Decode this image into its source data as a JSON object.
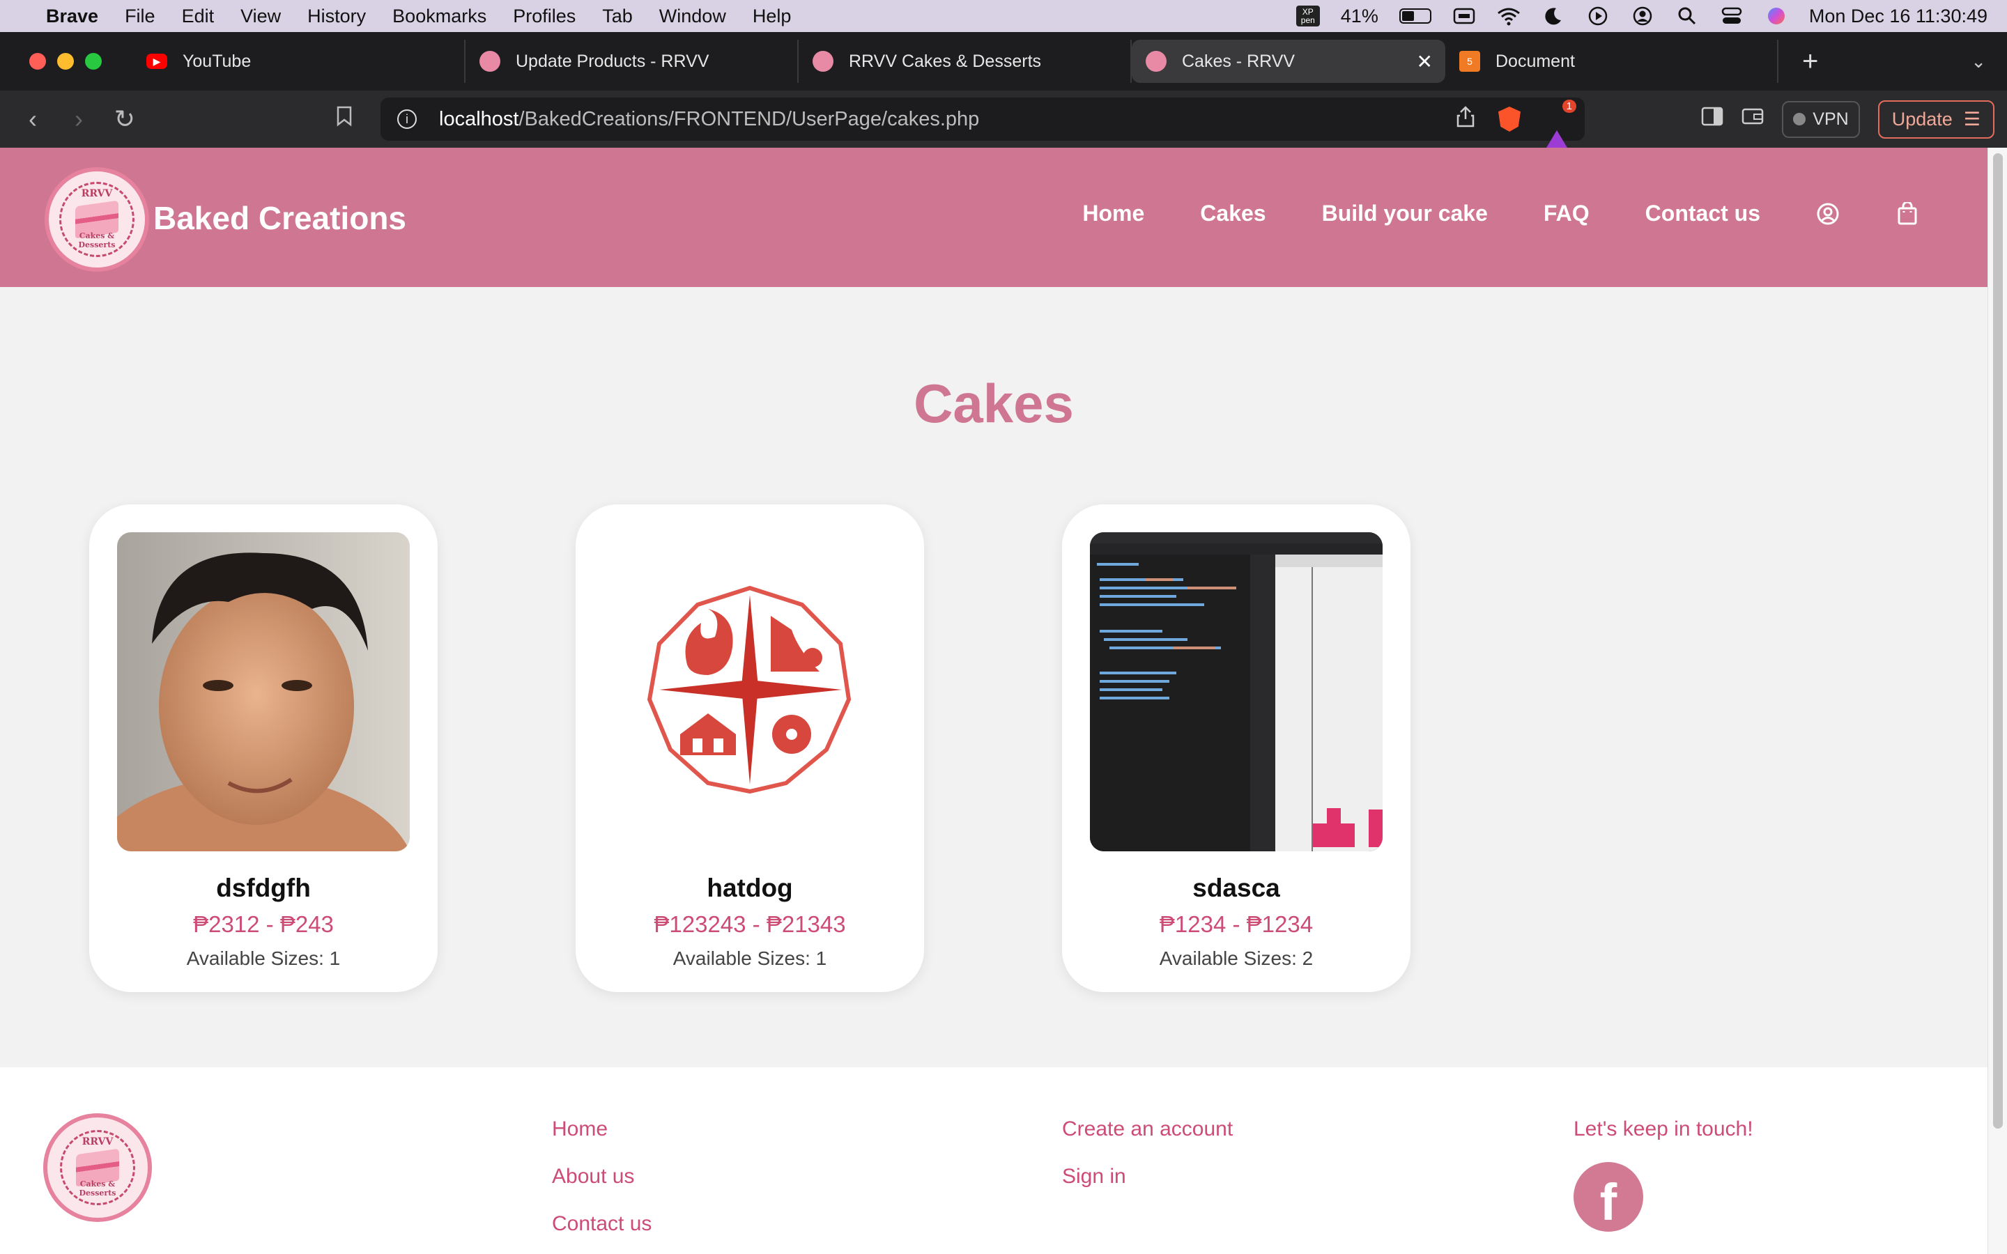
{
  "menubar": {
    "items": [
      "Brave",
      "File",
      "Edit",
      "View",
      "History",
      "Bookmarks",
      "Profiles",
      "Tab",
      "Window",
      "Help"
    ],
    "battery_percent": "41%",
    "battery_level": 0.41,
    "datetime": "Mon Dec 16  11:30:49",
    "xp_pen": "XP pen"
  },
  "tabs": [
    {
      "title": "YouTube",
      "favicon_color": "#ff0000",
      "active": false
    },
    {
      "title": "Update Products - RRVV",
      "favicon_color": "#e88aa5",
      "active": false
    },
    {
      "title": "RRVV Cakes & Desserts",
      "favicon_color": "#e88aa5",
      "active": false
    },
    {
      "title": "Cakes - RRVV",
      "favicon_color": "#e88aa5",
      "active": true
    },
    {
      "title": "Document",
      "favicon_color": "#f07b24",
      "active": false
    }
  ],
  "url": {
    "host": "localhost",
    "path": "/BakedCreations/FRONTEND/UserPage/cakes.php"
  },
  "toolbar": {
    "vpn_label": "VPN",
    "update_label": "Update",
    "bat_badge": "1"
  },
  "site": {
    "brand": "Baked Creations",
    "logo_top": "RRVV",
    "logo_bottom": "Cakes & Desserts",
    "nav": [
      "Home",
      "Cakes",
      "Build your cake",
      "FAQ",
      "Contact us"
    ],
    "accent": "#cf7692",
    "price_color": "#cd4c76"
  },
  "page": {
    "title": "Cakes"
  },
  "products": [
    {
      "name": "dsfdgfh",
      "price": "₱2312 - ₱243",
      "sizes": "Available Sizes: 1",
      "image": "photo-portrait"
    },
    {
      "name": "hatdog",
      "price": "₱123243 - ₱21343",
      "sizes": "Available Sizes: 1",
      "image": "disaster-emblem"
    },
    {
      "name": "sdasca",
      "price": "₱1234 - ₱1234",
      "sizes": "Available Sizes: 2",
      "image": "code-editor-screenshot"
    }
  ],
  "footer": {
    "links_col1": [
      "Home",
      "About us",
      "Contact us"
    ],
    "links_col2": [
      "Create an account",
      "Sign in"
    ],
    "touch_label": "Let's keep in touch!",
    "social": "facebook-icon"
  }
}
